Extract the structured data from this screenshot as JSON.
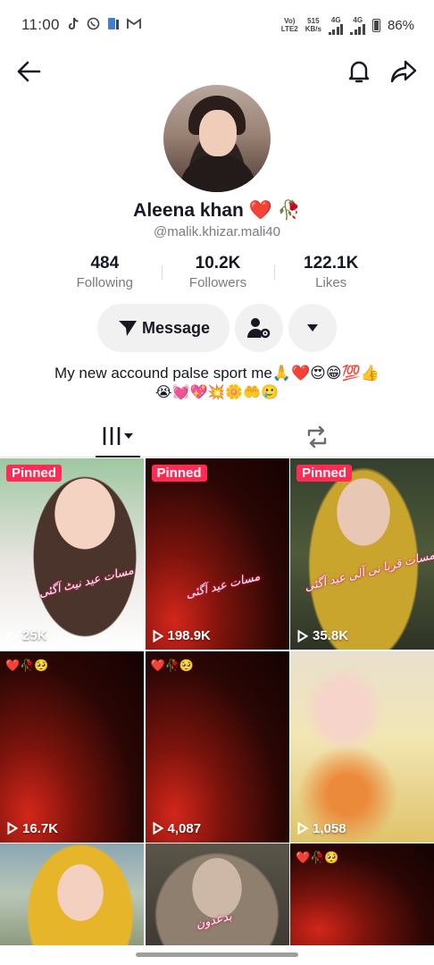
{
  "status_bar": {
    "time": "11:00",
    "notification_icons": [
      "tiktok-icon",
      "whatsapp-icon",
      "sim-icon",
      "gmail-icon"
    ],
    "network_volte": "Vo)",
    "network_lte": "LTE2",
    "speed_value": "515",
    "speed_unit": "KB/s",
    "sim1_label": "4G",
    "sim2_label": "4G",
    "battery": "86%"
  },
  "profile": {
    "display_name": "Aleena khan ❤️ 🥀",
    "handle": "@malik.khizar.mali40",
    "stats": [
      {
        "value": "484",
        "label": "Following"
      },
      {
        "value": "10.2K",
        "label": "Followers"
      },
      {
        "value": "122.1K",
        "label": "Likes"
      }
    ],
    "message_label": "Message",
    "bio_line1": "My new accound palse sport me🙏❤️😍😁💯👍",
    "bio_line2": "😭💓💖💥🌼🤲🥲"
  },
  "tabs": [
    {
      "icon": "videos-grid-icon",
      "active": true
    },
    {
      "icon": "repost-icon",
      "active": false
    }
  ],
  "videos": [
    {
      "pinned": true,
      "pinned_label": "Pinned",
      "views": "25K",
      "overlay_text": "مسات عید نیٹ آگئی",
      "emoji": ""
    },
    {
      "pinned": true,
      "pinned_label": "Pinned",
      "views": "198.9K",
      "overlay_text": "مسات عید آگئی",
      "emoji": ""
    },
    {
      "pinned": true,
      "pinned_label": "Pinned",
      "views": "35.8K",
      "overlay_text": "مسات قربا نی آلی عید آگئی",
      "emoji": ""
    },
    {
      "pinned": false,
      "pinned_label": "",
      "views": "16.7K",
      "overlay_text": "",
      "emoji": "❤️🥀🥺"
    },
    {
      "pinned": false,
      "pinned_label": "",
      "views": "4,087",
      "overlay_text": "",
      "emoji": "❤️🥀🥺"
    },
    {
      "pinned": false,
      "pinned_label": "",
      "views": "1,058",
      "overlay_text": "",
      "emoji": ""
    },
    {
      "pinned": false,
      "pinned_label": "",
      "views": "",
      "overlay_text": "",
      "emoji": ""
    },
    {
      "pinned": false,
      "pinned_label": "",
      "views": "",
      "overlay_text": "بدعدون",
      "emoji": ""
    },
    {
      "pinned": false,
      "pinned_label": "",
      "views": "",
      "overlay_text": "",
      "emoji": "❤️🥀🥺"
    }
  ],
  "colors": {
    "pinned_badge": "#fe2c55",
    "button_bg": "#f1f1f2",
    "text_primary": "#161823",
    "text_secondary": "#7a7b82"
  }
}
